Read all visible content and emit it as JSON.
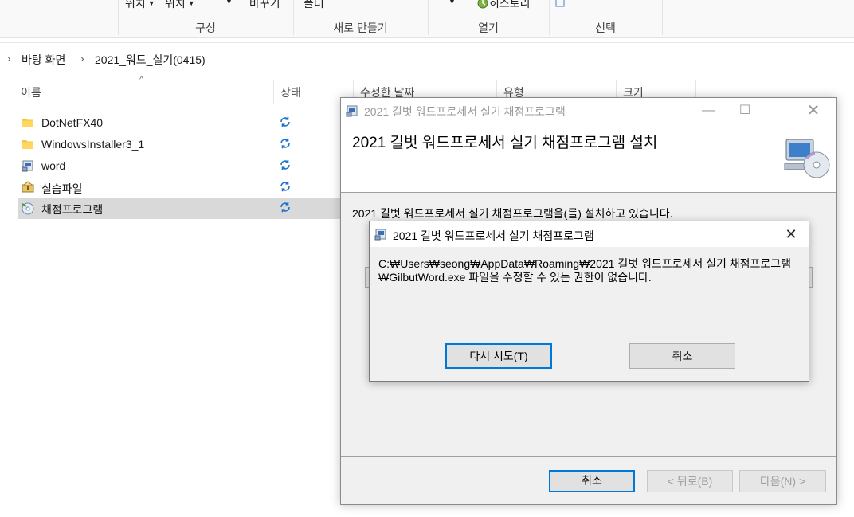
{
  "ribbon": {
    "top_labels": [
      "위치",
      "위치",
      "바꾸기",
      "폴더",
      "히스토리"
    ],
    "groups": [
      "구성",
      "새로 만들기",
      "열기",
      "선택"
    ]
  },
  "address": {
    "items": [
      "바탕 화면",
      "2021_워드_실기(0415)"
    ]
  },
  "file_list": {
    "columns": [
      "이름",
      "상태",
      "수정한 날짜",
      "유형",
      "크기"
    ],
    "rows": [
      {
        "name": "DotNetFX40",
        "icon": "folder-icon"
      },
      {
        "name": "WindowsInstaller3_1",
        "icon": "folder-icon"
      },
      {
        "name": "word",
        "icon": "setup-icon"
      },
      {
        "name": "실습파일",
        "icon": "archive-icon"
      },
      {
        "name": "채점프로그램",
        "icon": "installer-icon",
        "selected": true
      }
    ]
  },
  "installer": {
    "title": "2021 길벗 워드프로세서 실기 채점프로그램",
    "heading": "2021 길벗 워드프로세서 실기 채점프로그램 설치",
    "body": "2021 길벗 워드프로세서 실기 채점프로그램을(를) 설치하고 있습니다.",
    "buttons": {
      "cancel": "취소",
      "back": "< 뒤로(B)",
      "next": "다음(N) >"
    }
  },
  "error_dialog": {
    "title": "2021 길벗 워드프로세서 실기 채점프로그램",
    "message": "C:₩Users₩seong₩AppData₩Roaming₩2021 길벗 워드프로세서 실기 채점프로그램₩GilbutWord.exe 파일을 수정할 수 있는 권한이 없습니다.",
    "buttons": {
      "retry": "다시 시도(T)",
      "cancel": "취소"
    }
  },
  "colors": {
    "accent": "#0078d7",
    "sync": "#1e73c9",
    "folder": "#f4c542"
  }
}
